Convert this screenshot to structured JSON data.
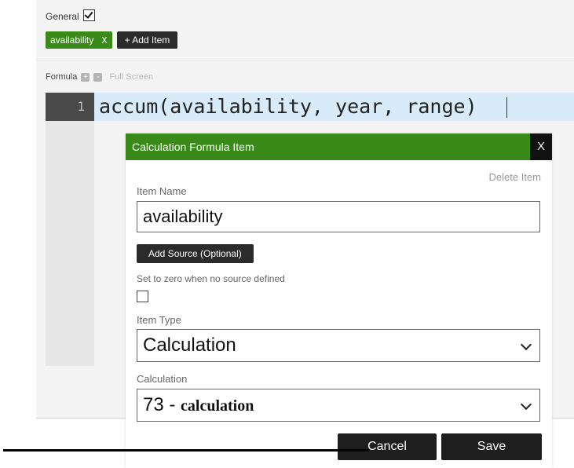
{
  "general": {
    "label": "General",
    "checked": true
  },
  "tags": [
    {
      "label": "availability",
      "remove": "X"
    }
  ],
  "add_item_label": "+ Add Item",
  "formula": {
    "label": "Formula",
    "plus": "+",
    "minus": "-",
    "fullscreen": "Full Screen"
  },
  "editor": {
    "line_number": "1",
    "code": "accum(availability, year, range)"
  },
  "modal": {
    "title": "Calculation Formula Item",
    "close": "X",
    "delete_item": "Delete Item",
    "item_name_label": "Item Name",
    "item_name_value": "availability",
    "add_source": "Add Source (Optional)",
    "zero_label": "Set to zero when no source defined",
    "zero_checked": false,
    "item_type_label": "Item Type",
    "item_type_value": "Calculation",
    "calculation_label": "Calculation",
    "calculation_value": "73 - ",
    "calculation_value_bold": "calculation",
    "cancel": "Cancel",
    "save": "Save"
  },
  "colors": {
    "green": "#3a8a1a",
    "dark": "#1e1e1e",
    "code_highlight": "#d8ebf8"
  }
}
